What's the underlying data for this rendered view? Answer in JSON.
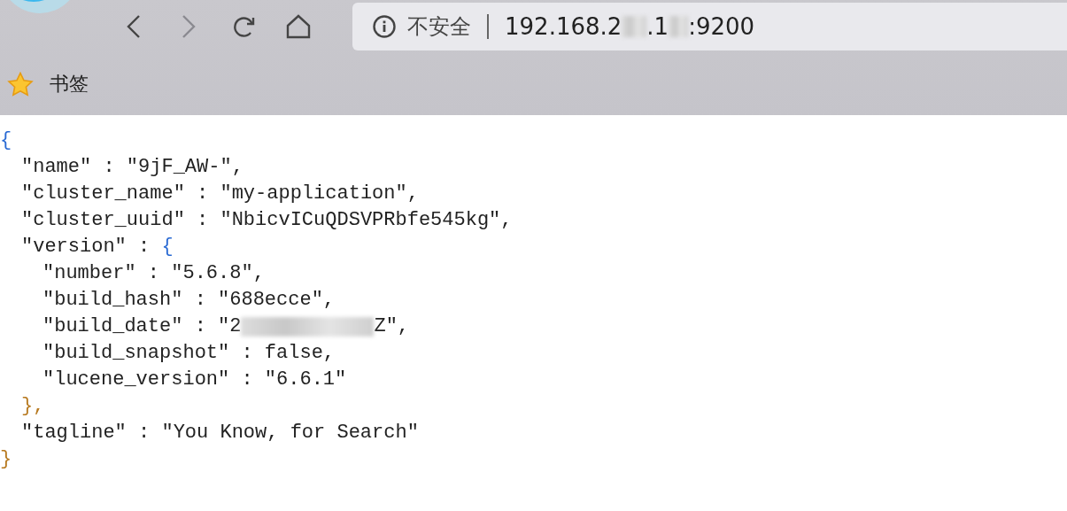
{
  "browser": {
    "nav_buttons": [
      {
        "kind": "back",
        "disabled": false
      },
      {
        "kind": "forward",
        "disabled": true
      },
      {
        "kind": "reload",
        "disabled": false
      },
      {
        "kind": "home",
        "disabled": false
      }
    ],
    "address_bar": {
      "security_label": "不安全",
      "url_parts": [
        "192.168.2",
        ".1",
        ":9200"
      ]
    },
    "bookmarks_bar": {
      "label": "书签"
    }
  },
  "json_view": {
    "open": "{",
    "close": "}",
    "entries": [
      {
        "key": "\"name\"",
        "sep": " : ",
        "value_parts": [
          "\"9jF_AW-\","
        ]
      },
      {
        "key": "\"cluster_name\"",
        "sep": " : ",
        "value_parts": [
          "\"my-application\","
        ]
      },
      {
        "key": "\"cluster_uuid\"",
        "sep": " : ",
        "value_parts": [
          "\"NbicvICuQDSVPRbfe545kg\","
        ]
      },
      {
        "key": "\"version\"",
        "sep": " : ",
        "value_parts": [
          "{"
        ],
        "close": "},",
        "children": [
          {
            "key": "\"number\"",
            "sep": " : ",
            "value_parts": [
              "\"5.6.8\","
            ]
          },
          {
            "key": "\"build_hash\"",
            "sep": " : ",
            "value_parts": [
              "\"688ecce\","
            ]
          },
          {
            "key": "\"build_date\"",
            "sep": " : ",
            "value_parts": [
              "\"2",
              "Z\","
            ]
          },
          {
            "key": "\"build_snapshot\"",
            "sep": " : ",
            "value_parts": [
              "false,"
            ]
          },
          {
            "key": "\"lucene_version\"",
            "sep": " : ",
            "value_parts": [
              "\"6.6.1\""
            ]
          }
        ]
      },
      {
        "key": "\"tagline\"",
        "sep": " : ",
        "value_parts": [
          "\"You Know, for Search\""
        ]
      }
    ]
  }
}
